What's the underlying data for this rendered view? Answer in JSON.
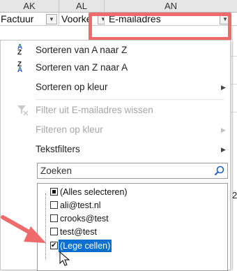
{
  "columns": {
    "ak": "AK",
    "al": "AL",
    "an": "AN"
  },
  "header_cells": {
    "factuur": "Factuur",
    "voornaam": "Voorke",
    "email": "E-mailadres"
  },
  "highlight_color": "#ef6a6a",
  "menu": {
    "sort_az": "Sorteren van A naar Z",
    "sort_za": "Sorteren van Z naar A",
    "sort_color": "Sorteren op kleur",
    "clear_filter": "Filter uit E-mailadres wissen",
    "filter_color": "Filteren op kleur",
    "text_filters": "Tekstfilters"
  },
  "search": {
    "placeholder": "Zoeken"
  },
  "list": {
    "select_all": "(Alles selecteren)",
    "items": [
      "ali@test.nl",
      "crooks@test",
      "test@test"
    ],
    "blanks": "(Lege cellen)"
  },
  "side_char": "2",
  "accent": "#0a6fd1"
}
